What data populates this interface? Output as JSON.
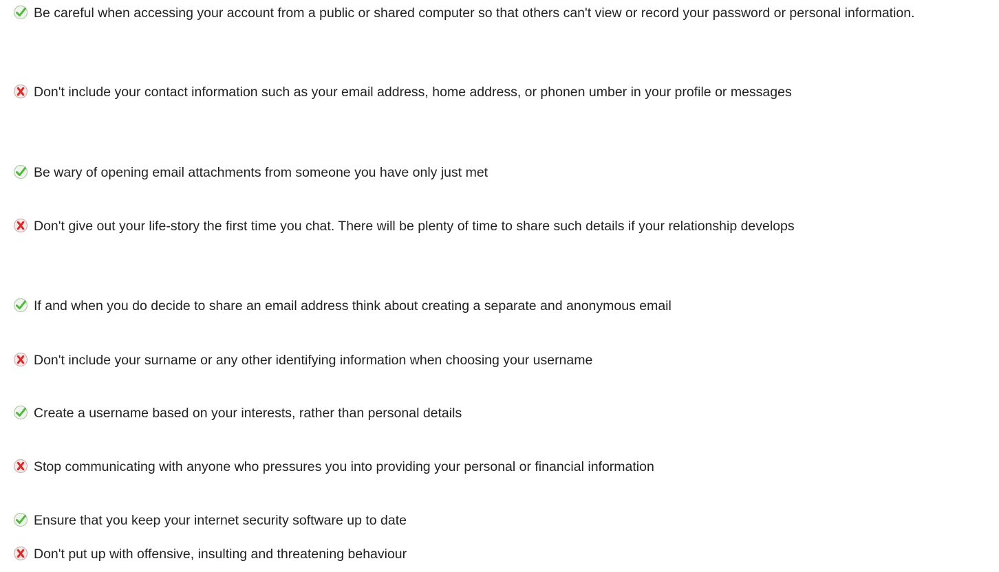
{
  "tips": [
    {
      "type": "do",
      "icon": "check-icon",
      "text": "Be careful when accessing your account from a public or shared computer so that others can't view or record your password or personal information."
    },
    {
      "type": "dont",
      "icon": "x-icon",
      "text": "Don't include your contact information such as your email address, home address, or phonen umber in your profile or messages"
    },
    {
      "type": "do",
      "icon": "check-icon",
      "text": "Be wary of opening email attachments from someone you have only just met"
    },
    {
      "type": "dont",
      "icon": "x-icon",
      "text": "Don't give out your life-story the first time you chat. There will be plenty of time to share such details if your relationship develops"
    },
    {
      "type": "do",
      "icon": "check-icon",
      "text": "If and when you do decide to share an email address think about creating a separate and anonymous email"
    },
    {
      "type": "dont",
      "icon": "x-icon",
      "text": "Don't include your surname or any other identifying information when choosing your username"
    },
    {
      "type": "do",
      "icon": "check-icon",
      "text": "Create a username based on your interests, rather than personal details"
    },
    {
      "type": "dont",
      "icon": "x-icon",
      "text": "Stop communicating with anyone who pressures you into providing your personal or financial information"
    },
    {
      "type": "do",
      "icon": "check-icon",
      "text": "Ensure that you keep your internet security software up to date"
    },
    {
      "type": "dont",
      "icon": "x-icon",
      "text": "Don't put up with offensive, insulting and threatening behaviour"
    }
  ],
  "colors": {
    "text": "#222222",
    "check_green": "#4fb83a",
    "x_red": "#d52b2b"
  }
}
